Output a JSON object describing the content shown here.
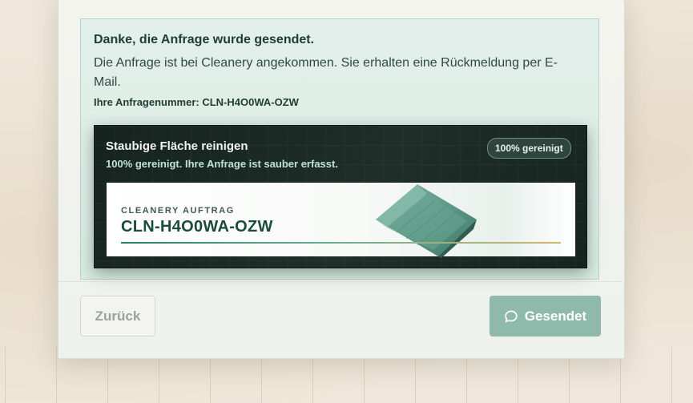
{
  "confirmation": {
    "title": "Danke, die Anfrage wurde gesendet.",
    "body": "Die Anfrage ist bei Cleanery angekommen. Sie erhalten eine Rückmeldung per E-Mail.",
    "reference": "Ihre Anfragenummer: CLN-H4O0WA-OZW"
  },
  "task_card": {
    "title": "Staubige Fläche reinigen",
    "subtitle": "100% gereinigt. Ihre Anfrage ist sauber erfasst.",
    "badge": "100% gereinigt",
    "ticket_label": "CLEANERY AUFTRAG",
    "ticket_number": "CLN-H4O0WA-OZW",
    "icon": "microfiber-cloth-image"
  },
  "footer": {
    "back_label": "Zurück",
    "send_label": "Gesendet",
    "send_icon": "chat-bubble-icon"
  },
  "colors": {
    "accent": "#2a8068",
    "send_button": "#8fb9aa",
    "success_bg": "#d9ebe4",
    "dark_panel": "#1b2925"
  }
}
